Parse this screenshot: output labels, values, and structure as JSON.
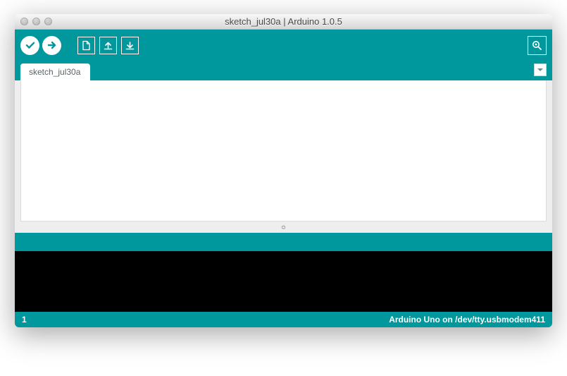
{
  "window": {
    "title": "sketch_jul30a | Arduino 1.0.5"
  },
  "tabs": [
    {
      "label": "sketch_jul30a"
    }
  ],
  "editor": {
    "content": ""
  },
  "console": {
    "content": ""
  },
  "footer": {
    "line_number": "1",
    "board_status": "Arduino Uno on /dev/tty.usbmodem411"
  },
  "colors": {
    "accent": "#00979d"
  }
}
